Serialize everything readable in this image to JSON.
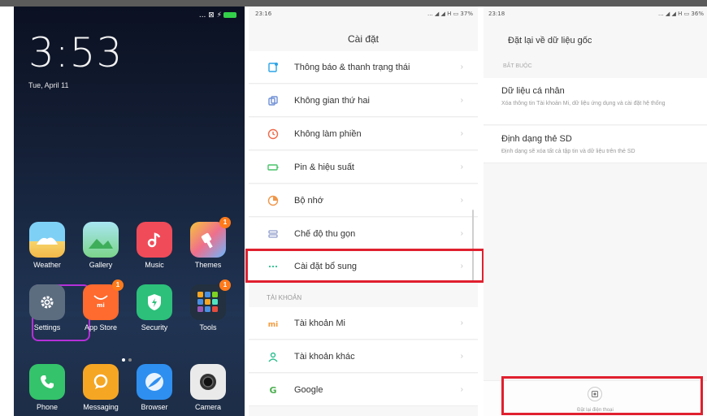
{
  "home": {
    "status": "... ⊠ ⚡",
    "clock": "3:53",
    "date": "Tue, April 11",
    "apps": [
      {
        "label": "Weather",
        "icon": "weather-icon"
      },
      {
        "label": "Gallery",
        "icon": "gallery-icon"
      },
      {
        "label": "Music",
        "icon": "music-icon"
      },
      {
        "label": "Themes",
        "icon": "themes-icon",
        "badge": "1"
      },
      {
        "label": "Settings",
        "icon": "gear-icon"
      },
      {
        "label": "App Store",
        "icon": "app-store-icon",
        "badge": "1"
      },
      {
        "label": "Security",
        "icon": "security-icon"
      },
      {
        "label": "Tools",
        "icon": "tools-icon",
        "badge": "1"
      },
      {
        "label": "Phone",
        "icon": "phone-icon"
      },
      {
        "label": "Messaging",
        "icon": "messaging-icon"
      },
      {
        "label": "Browser",
        "icon": "browser-icon"
      },
      {
        "label": "Camera",
        "icon": "camera-icon"
      }
    ]
  },
  "settings": {
    "time": "23:16",
    "status_right": "... ◢ ◢ H ▭ 37%",
    "title": "Cài đặt",
    "items": [
      {
        "label": "Thông báo & thanh trạng thái",
        "icon": "notification-icon",
        "color": "#2aa3e6"
      },
      {
        "label": "Không gian thứ hai",
        "icon": "second-space-icon",
        "color": "#6f8fd6"
      },
      {
        "label": "Không làm phiền",
        "icon": "do-not-disturb-icon",
        "color": "#f06a4a"
      },
      {
        "label": "Pin & hiệu suất",
        "icon": "battery-icon",
        "color": "#49c36a"
      },
      {
        "label": "Bộ nhớ",
        "icon": "storage-icon",
        "color": "#f0964a"
      },
      {
        "label": "Chế độ thu gọn",
        "icon": "one-handed-icon",
        "color": "#8f9ccc"
      },
      {
        "label": "Cài đặt bổ sung",
        "icon": "more-dots-icon",
        "color": "#2bbf8f"
      }
    ],
    "accounts_section": "TÀI KHOẢN",
    "accounts": [
      {
        "label": "Tài khoản Mi",
        "icon": "mi-icon",
        "color": "#f29a3a"
      },
      {
        "label": "Tài khoản khác",
        "icon": "user-icon",
        "color": "#2bbf8f"
      },
      {
        "label": "Google",
        "icon": "google-icon",
        "color": "#4caf50"
      }
    ]
  },
  "reset": {
    "time": "23:18",
    "status_right": "... ◢ ◢ H ▭ 36%",
    "title": "Đặt lại về dữ liệu gốc",
    "section": "BẮT BUỘC",
    "options": [
      {
        "title": "Dữ liệu cá nhân",
        "desc": "Xóa thông tin Tài khoản Mi, dữ liệu ứng dụng và cài đặt hệ thống"
      },
      {
        "title": "Định dạng thẻ SD",
        "desc": "Định dạng sẽ xóa tất cả tập tin và dữ liệu trên thẻ SD"
      }
    ],
    "button_label": "Đặt lại điện thoại"
  },
  "colors": {
    "highlight_red": "#e0202e",
    "highlight_purple": "#b530d8",
    "badge": "#ff7a1a"
  }
}
